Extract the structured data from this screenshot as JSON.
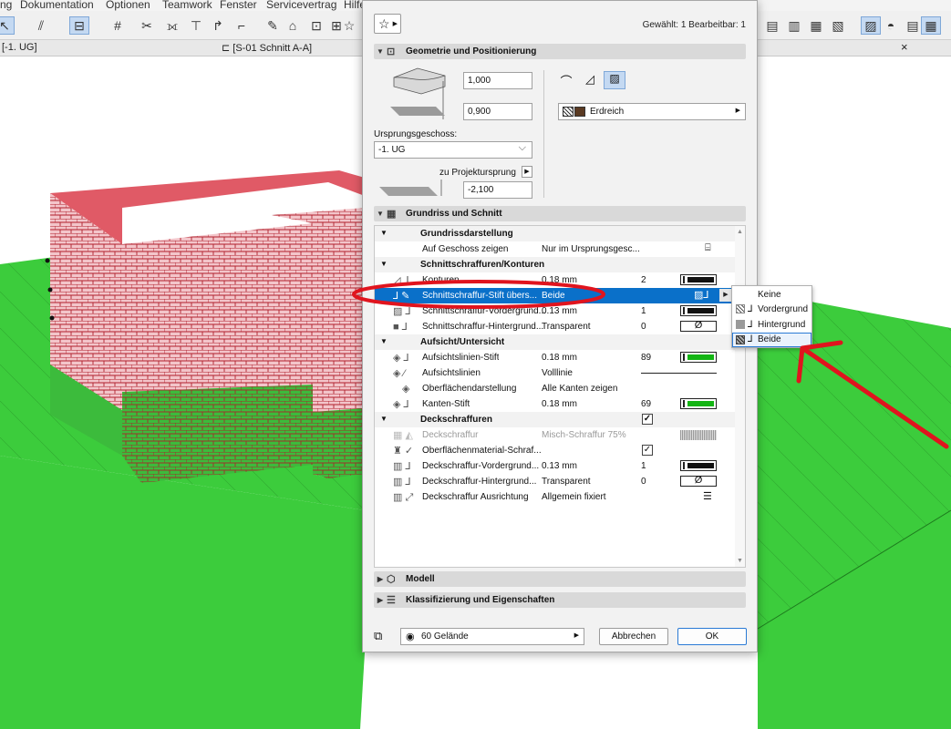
{
  "menu": {
    "items": [
      "ng",
      "Dokumentation",
      "Optionen",
      "Teamwork",
      "Fenster",
      "Servicevertrag",
      "Hilfe"
    ]
  },
  "tabs": {
    "floor_tab": "[-1. UG]",
    "section_tab": "[S-01 Schnitt A-A]",
    "close_glyph": "×"
  },
  "dialog": {
    "favorites_icon": "star-icon",
    "selected_info": "Gewählt: 1 Bearbeitbar: 1",
    "panels": {
      "geometry": "Geometrie und Positionierung",
      "floorplan": "Grundriss und Schnitt",
      "model": "Modell",
      "classification": "Klassifizierung und Eigenschaften"
    },
    "geometry": {
      "thickness": "1,000",
      "offset": "0,900",
      "home_story_label": "Ursprungsgeschoss:",
      "home_story_value": "-1. UG",
      "project_origin_label": "zu Projektursprung",
      "elevation": "-2,100",
      "building_material": "Erdreich"
    },
    "list": {
      "sub_floorplan_display": "Grundrissdarstellung",
      "show_on_story_label": "Auf Geschoss zeigen",
      "show_on_story_value": "Nur im Ursprungsgesc...",
      "sub_cut_fills": "Schnittschraffuren/Konturen",
      "cut_lines_label": "Konturen",
      "cut_lines_value": "0.18 mm",
      "cut_lines_pen": "2",
      "cut_fill_pen_override_label": "Schnittschraffur-Stift übers...",
      "cut_fill_pen_override_value": "Beide",
      "cut_fill_fg_label": "Schnittschraffur-Vordergrund...",
      "cut_fill_fg_value": "0.13 mm",
      "cut_fill_fg_pen": "1",
      "cut_fill_bg_label": "Schnittschraffur-Hintergrund...",
      "cut_fill_bg_value": "Transparent",
      "cut_fill_bg_pen": "0",
      "empty_symbol": "Ø",
      "sub_outline": "Aufsicht/Untersicht",
      "uncut_pen_label": "Aufsichtslinien-Stift",
      "uncut_pen_value": "0.18 mm",
      "uncut_pen_num": "89",
      "uncut_lines_label": "Aufsichtslinien",
      "uncut_lines_value": "Volllinie",
      "surface_display_label": "Oberflächendarstellung",
      "surface_display_value": "Alle Kanten zeigen",
      "edge_pen_label": "Kanten-Stift",
      "edge_pen_value": "0.18 mm",
      "edge_pen_num": "69",
      "sub_cover_fills": "Deckschraffuren",
      "cover_fill_label": "Deckschraffur",
      "cover_fill_value": "Misch-Schraffur 75%",
      "surface_material_fill_label": "Oberflächenmaterial-Schraf...",
      "cover_fg_label": "Deckschraffur-Vordergrund...",
      "cover_fg_value": "0.13 mm",
      "cover_fg_pen": "1",
      "cover_bg_label": "Deckschraffur-Hintergrund...",
      "cover_bg_value": "Transparent",
      "cover_bg_pen": "0",
      "cover_orient_label": "Deckschraffur Ausrichtung",
      "cover_orient_value": "Allgemein fixiert",
      "checkmark": "✓"
    },
    "bottom": {
      "layer": "60 Gelände",
      "cancel": "Abbrechen",
      "ok": "OK"
    }
  },
  "popup": {
    "options": [
      "Keine",
      "Vordergrund",
      "Hintergrund",
      "Beide"
    ],
    "selected": "Beide"
  },
  "colors": {
    "terrain": "#3ccc3c",
    "wall_brick": "#f3c5ca",
    "brick_line": "#b0202c",
    "highlight_row": "#0a70c9",
    "annotation_red": "#e0141e"
  }
}
